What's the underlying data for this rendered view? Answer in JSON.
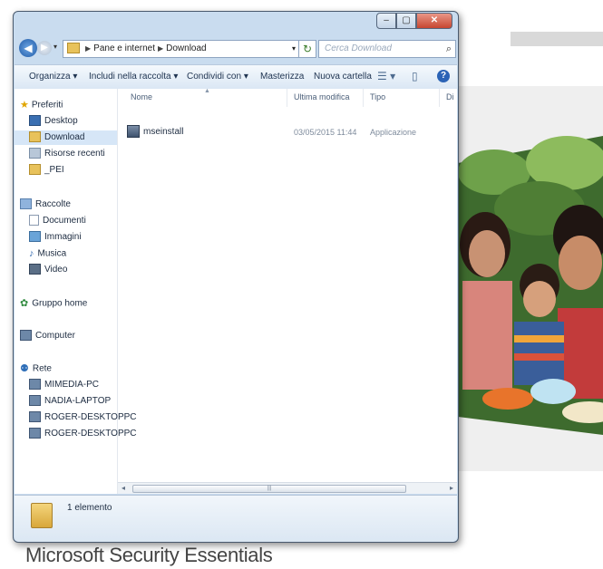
{
  "window": {
    "controls": {
      "minimize": "–",
      "maximize": "▢",
      "close": "✕"
    }
  },
  "nav": {
    "breadcrumb": [
      "Pane e internet",
      "Download"
    ],
    "search_placeholder": "Cerca Download"
  },
  "toolbar": {
    "items": [
      "Organizza ▾",
      "Includi nella raccolta ▾",
      "Condividi con ▾",
      "Masterizza",
      "Nuova cartella"
    ]
  },
  "sidebar": {
    "favorites_label": "Preferiti",
    "favorites": [
      "Desktop",
      "Download",
      "Risorse recenti",
      "_PEI"
    ],
    "libraries_label": "Raccolte",
    "libraries": [
      "Documenti",
      "Immagini",
      "Musica",
      "Video"
    ],
    "homegroup_label": "Gruppo home",
    "computer_label": "Computer",
    "network_label": "Rete",
    "network": [
      "MIMEDIA-PC",
      "NADIA-LAPTOP",
      "ROGER-DESKTOPPC",
      "ROGER-DESKTOPPC"
    ]
  },
  "columns": [
    "Nome",
    "Ultima modifica",
    "Tipo",
    "Di"
  ],
  "files": [
    {
      "name": "mseinstall",
      "modified": "03/05/2015 11:44",
      "type": "Applicazione"
    }
  ],
  "details": {
    "count": "1 elemento"
  },
  "background": {
    "footer_title": "Microsoft Security Essentials"
  }
}
